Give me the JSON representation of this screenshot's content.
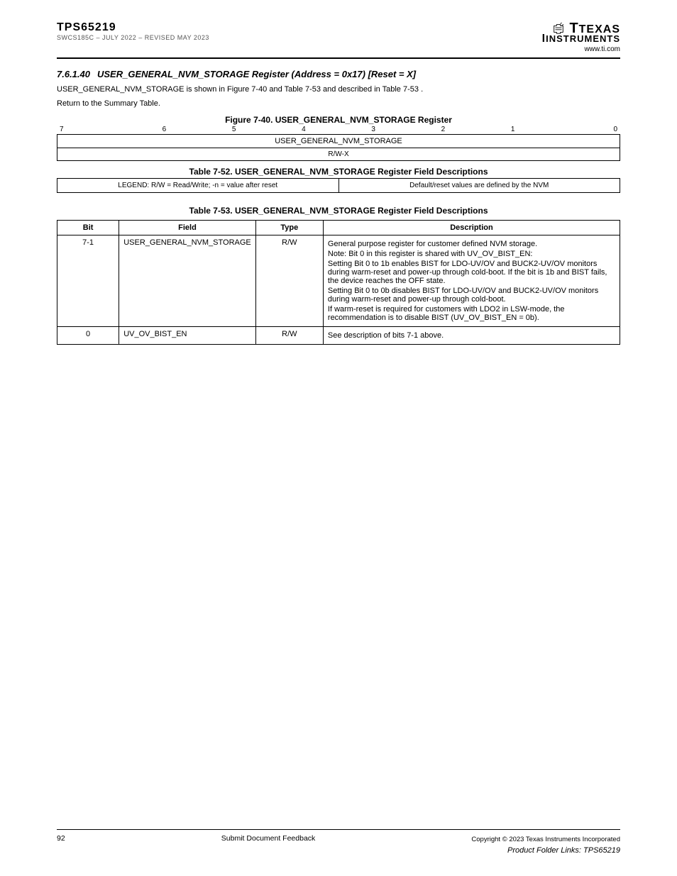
{
  "header": {
    "part": "TPS65219",
    "swcs": "SWCS185C – JULY 2022 – REVISED MAY 2023",
    "logo_top": "TEXAS",
    "logo_bottom": "INSTRUMENTS",
    "url": "www.ti.com"
  },
  "sections": {
    "s1_no": "7.6.1.40",
    "s1_ttl": "USER_GENERAL_NVM_STORAGE Register (Address = 0x17) [Reset = X]",
    "s1_p1_a": "USER_GENERAL_NVM_STORAGE is shown in ",
    "s1_p1_link1": "Figure 7-40",
    "s1_p1_b": " and ",
    "s1_p1_link2": "Table 7-53",
    "s1_p1_c": " and described in ",
    "s1_p1_link3": "Table 7-53",
    "s1_p1_d": ".",
    "s1_p2": "Return to the Summary Table."
  },
  "fig40": {
    "caption": "Figure 7-40. USER_GENERAL_NVM_STORAGE Register",
    "bits_left": "7",
    "bits_b6": "6",
    "bits_b5": "5",
    "bits_b4": "4",
    "bits_b3": "3",
    "bits_b2": "2",
    "bits_b1": "1",
    "bits_right": "0",
    "field": "USER_GENERAL_NVM_STORAGE",
    "rw": "R/W-X"
  },
  "t52": {
    "caption": "Table 7-52. USER_GENERAL_NVM_STORAGE Register Field Descriptions",
    "left": "LEGEND: R/W = Read/Write; -n = value after reset",
    "right": "Default/reset values are defined by the NVM"
  },
  "t53": {
    "caption": "Table 7-53. USER_GENERAL_NVM_STORAGE Register Field Descriptions",
    "hdr_bit": "Bit",
    "hdr_field": "Field",
    "hdr_type": "Type",
    "hdr_desc": "Description",
    "rows": [
      {
        "bit": "7-1",
        "field": "USER_GENERAL_NVM_STORAGE",
        "type": "R/W",
        "desc_lines": [
          "General purpose register for customer defined NVM storage.",
          "Note: Bit 0 in this register is shared with UV_OV_BIST_EN:",
          "Setting Bit 0 to 1b enables BIST for LDO-UV/OV and BUCK2-UV/OV monitors during warm-reset and power-up through cold-boot. If the bit is 1b and BIST fails, the device reaches the OFF state.",
          "Setting Bit 0 to 0b disables BIST for LDO-UV/OV and BUCK2-UV/OV monitors during warm-reset and power-up through cold-boot.",
          "If warm-reset is required for customers with LDO2 in LSW-mode, the recommendation is to disable BIST (UV_OV_BIST_EN = 0b)."
        ]
      },
      {
        "bit": "0",
        "field": "UV_OV_BIST_EN",
        "type": "R/W",
        "desc_lines": [
          "See description of bits 7-1 above."
        ]
      }
    ]
  },
  "footer": {
    "page": "92",
    "center": "Submit Document Feedback",
    "right1": "Copyright © 2023 Texas Instruments Incorporated",
    "pfback": "Product Folder Links: TPS65219"
  }
}
